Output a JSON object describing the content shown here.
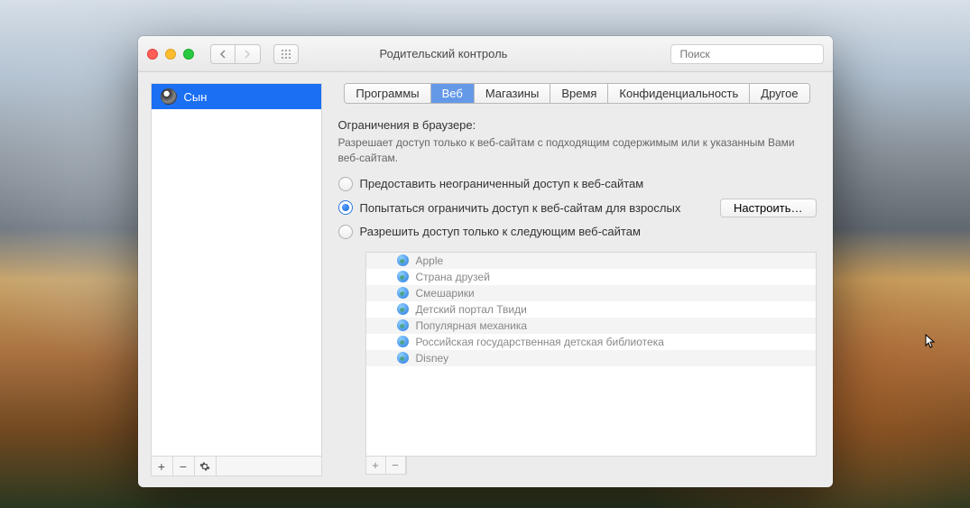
{
  "window": {
    "title": "Родительский контроль",
    "search_placeholder": "Поиск"
  },
  "sidebar": {
    "users": [
      {
        "name": "Сын"
      }
    ]
  },
  "tabs": {
    "items": [
      "Программы",
      "Веб",
      "Магазины",
      "Время",
      "Конфиденциальность",
      "Другое"
    ],
    "active_index": 1
  },
  "web": {
    "section_title": "Ограничения в браузере:",
    "help_text": "Разрешает доступ только к веб-сайтам с подходящим содержимым или к указанным Вами веб-сайтам.",
    "radios": [
      {
        "label": "Предоставить неограниченный доступ к веб-сайтам",
        "checked": false
      },
      {
        "label": "Попытаться ограничить доступ к веб-сайтам для взрослых",
        "checked": true
      },
      {
        "label": "Разрешить доступ только к следующим веб-сайтам",
        "checked": false
      }
    ],
    "configure_button": "Настроить…",
    "sites": [
      "Apple",
      "Страна друзей",
      "Смешарики",
      "Детский портал Твиди",
      "Популярная механика",
      "Российская государственная детская библиотека",
      "Disney"
    ]
  }
}
